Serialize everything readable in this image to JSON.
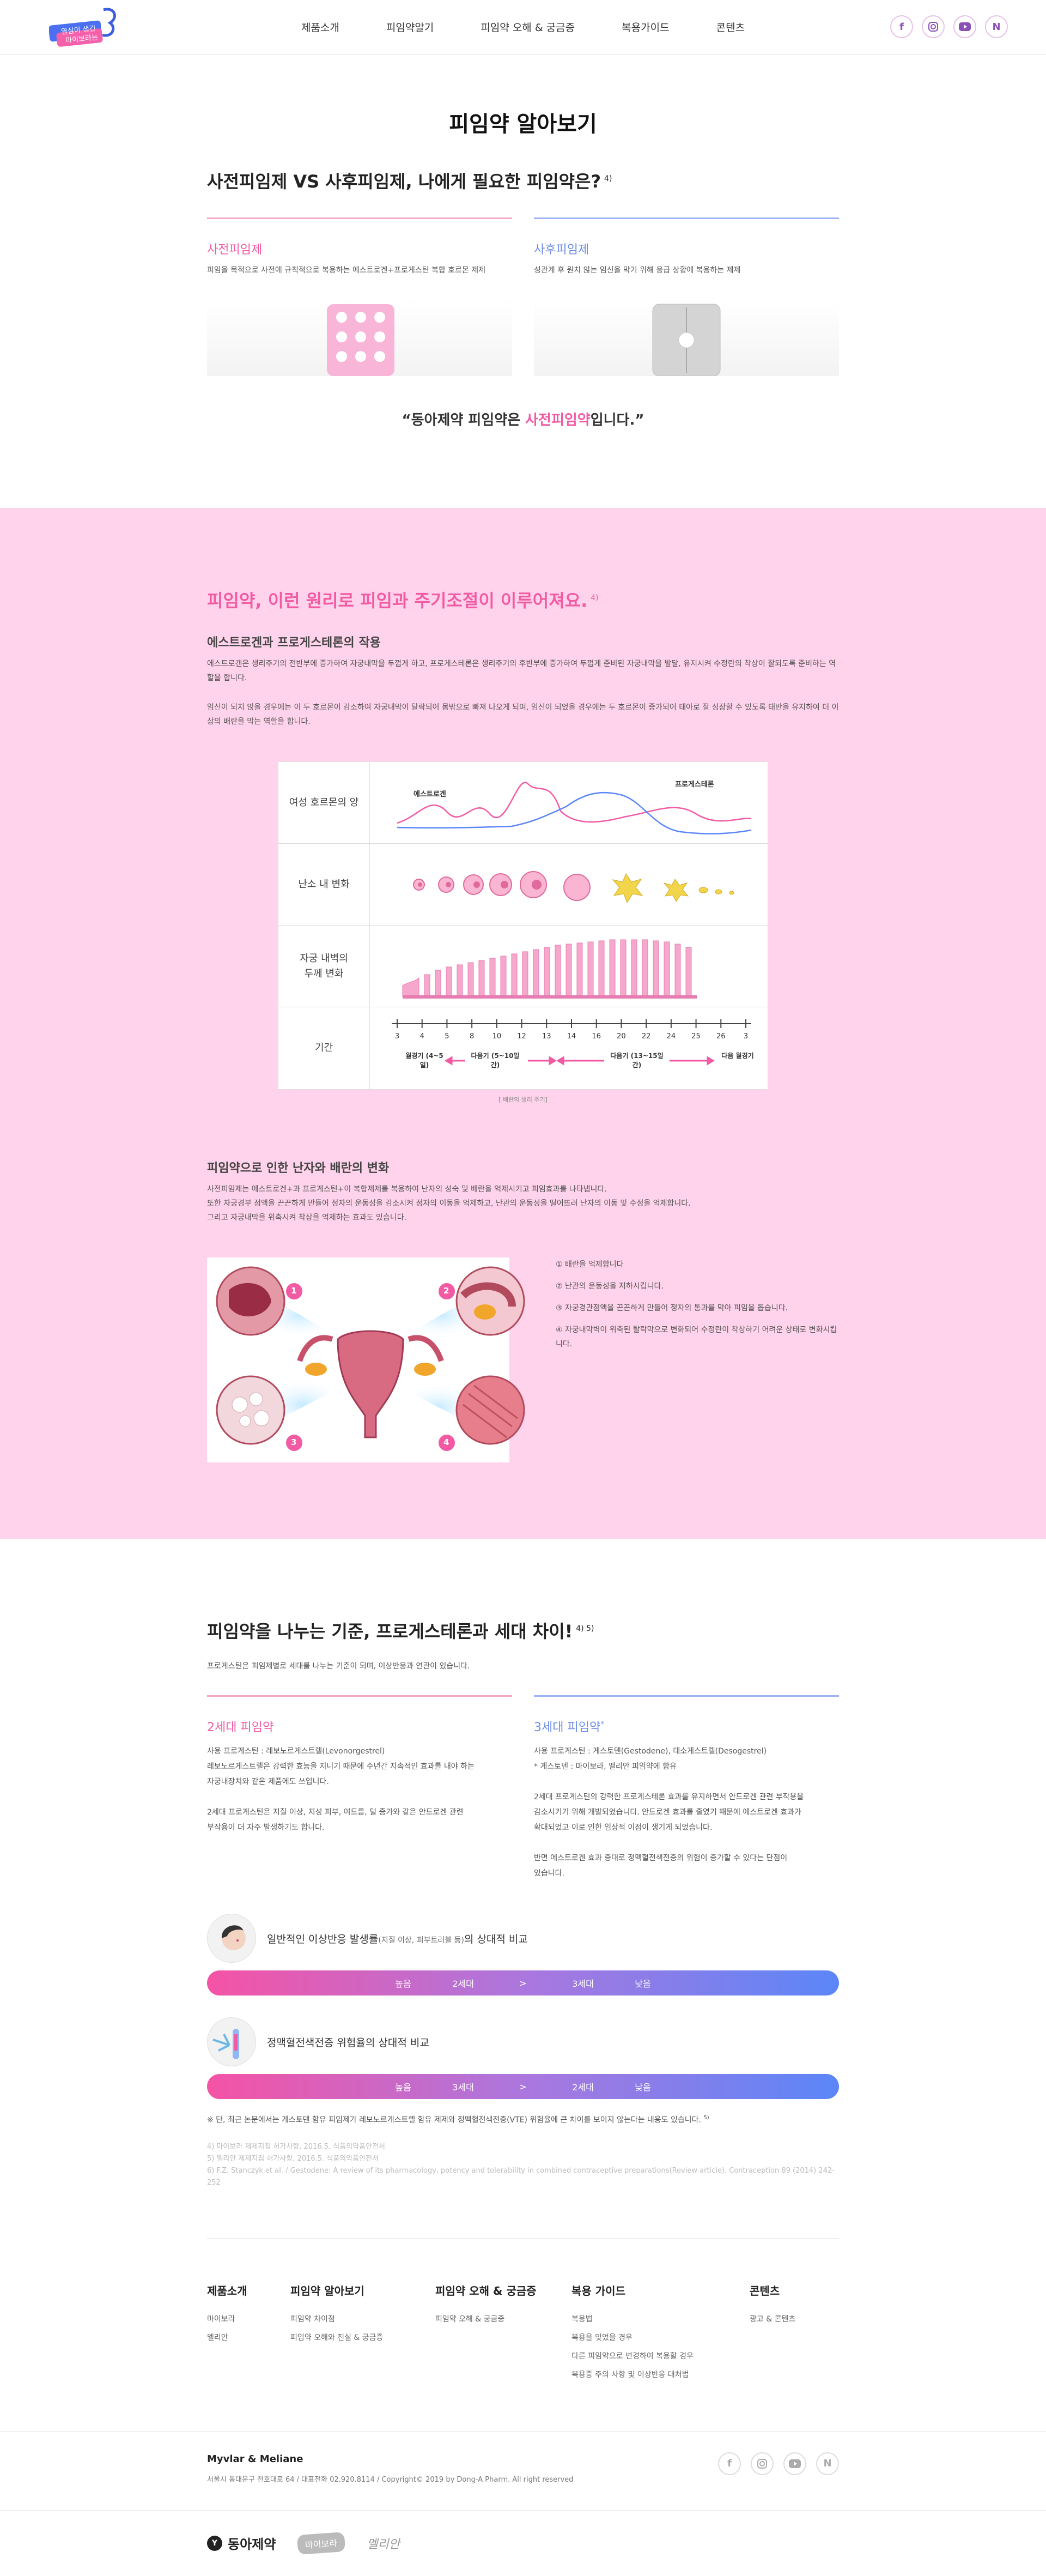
{
  "header": {
    "logo_alt": "Dong-A Pharm Myvlar",
    "nav": [
      "제품소개",
      "피임약알기",
      "피임약 오해 & 궁금증",
      "복용가이드",
      "콘텐츠"
    ],
    "sns": [
      "facebook-icon",
      "instagram-icon",
      "youtube-icon",
      "naver-icon"
    ]
  },
  "page_title": "피임약 알아보기",
  "section1": {
    "title": "사전피임제 VS 사후피임제, 나에게 필요한 피임약은?",
    "title_ref": "4)",
    "left_head": "사전피임제",
    "left_desc": "피임을 목적으로 사전에 규칙적으로 복용하는 에스트로겐+프로게스틴 복합 호르몬 제제",
    "right_head": "사후피임제",
    "right_desc": "성관계 후 원치 않는 임신을 막기 위해 응급 상황에 복용하는 제제",
    "quote_prefix": "“동아제약 피임약은 ",
    "quote_highlight": "사전피임약",
    "quote_suffix": "입니다.”"
  },
  "section2": {
    "title": "피임약, 이런 원리로 피임과 주기조절이 이루어져요.",
    "title_ref": "4)",
    "sub1": "에스트로겐과 프로게스테론의 작용",
    "p1": "에스트로겐은 생리주기의 전반부에 증가하여 자궁내막을 두껍게 하고, 프로게스테론은 생리주기의 후반부에 증가하여 두껍게 준비된 자궁내막을 발달, 유지시켜 수정란의 착상이 잘되도록 준비하는 역할을 합니다.",
    "p2": "임신이 되지 않을 경우에는 이 두 호르몬이 감소하여 자궁내막이 탈락되어 몸밖으로 빠져 나오게 되며, 임신이 되었을 경우에는 두 호르몬이 증가되어 태아로 잘 성장할 수 있도록 태반을 유지하여 더 이상의 배란을 막는 역할을 합니다.",
    "chart": {
      "row1_label": "여성 호르몬의 양",
      "estrogen": "에스트로겐",
      "progesterone": "프로게스테론",
      "row2_label": "난소 내 변화",
      "row3_label": "자궁 내벽의 두께 변화",
      "row4_label": "기간",
      "days": [
        "3",
        "4",
        "5",
        "8",
        "10",
        "12",
        "13",
        "14",
        "16",
        "20",
        "22",
        "24",
        "25",
        "26",
        "3"
      ],
      "phase1": "월경기 (4~5일)",
      "phase2": "다음기 (5~10일간)",
      "phase3": "다음기 (13~15일간)",
      "phase4": "다음 월경기",
      "note": "[ 배란의 생리 주기]"
    },
    "sub2": "피임약으로 인한 난자와 배란의 변화",
    "p3": "사전피임제는 에스트로겐+과 프로게스틴+이 복합제제를 복용하여 난자의 성숙 및 배란을 억제시키고 피임효과를 나타냅니다.",
    "p4": "또한 자궁경부 점액을 끈끈하게 만들어 정자의 운동성을 감소시켜 정자의 이동을 억제하고, 난관의 운동성을 떨어뜨려 난자의 이동 및 수정을 억제합니다.",
    "p5": "그리고 자궁내막을 위축시켜 착상을 억제하는 효과도 있습니다.",
    "list": [
      "① 배란을 억제합니다",
      "② 난관의 운동성을 저하시킵니다.",
      "③ 자궁경관점액을 끈끈하게 만들어 정자의 통과를 막아 피임을 돕습니다.",
      "④ 자궁내막벽이 위축된 탈락막으로 변화되어 수정란이 착상하기 어려운 상태로 변화시킵니다."
    ],
    "markers": [
      "1",
      "2",
      "3",
      "4"
    ]
  },
  "section3": {
    "title": "피임약을 나누는 기준, 프로게스테론과 세대 차이!",
    "title_ref": "4) 5)",
    "intro": "프로게스틴은 피임제별로 세대를 나누는 기준이 되며, 이상반응과 연관이 있습니다.",
    "left_head": "2세대 피임약",
    "left_l1": "사용 프로게스틴 : 레보노르게스트렐(Levonorgestrel)",
    "left_l2": "레보노르게스트렐은 강력한 효능을 지니기 때문에 수년간 지속적인 효과를 내야 하는",
    "left_l3": "자궁내장치와 같은 제품에도 쓰입니다.",
    "left_l4": "2세대 프로게스틴은 지질 이상, 지성 피부, 여드름, 털 증가와 같은 안드로겐 관련",
    "left_l5": "부작용이 더 자주 발생하기도 합니다.",
    "right_head": "3세대 피임약",
    "right_head_mark": "*",
    "right_l1": "사용 프로게스틴 : 게스토덴(Gestodene), 데소게스트렐(Desogestrel)",
    "right_l2": "* 게스토덴 : 마이보라, 멜리안 피임약에 함유",
    "right_l3": "2세대 프로게스틴의 강력한 프로게스테론 효과를 유지하면서 안드로겐 관련 부작용을",
    "right_l4": "감소시키기 위해 개발되었습니다. 안드로겐 효과를 줄였기 때문에 에스트로겐 효과가",
    "right_l5": "확대되었고 이로 인한 임상적 이점이 생기게 되었습니다.",
    "right_l6": "반면 에스트로겐 효과 증대로 정맥혈전색전증의 위험이 증가할 수 있다는 단점이",
    "right_l7": "있습니다.",
    "bar1_title": "일반적인 이상반응 발생률",
    "bar1_small": "(지질 이상, 피부트러블 등)",
    "bar1_suffix": "의 상대적 비교",
    "bar1": [
      "높음",
      "2세대",
      ">",
      "3세대",
      "낮음"
    ],
    "bar2_title": "정맥혈전색전증 위험율의 상대적 비교",
    "bar2": [
      "높음",
      "3세대",
      ">",
      "2세대",
      "낮음"
    ],
    "bar_note": "※ 단, 최근 논문에서는 게스토덴 함유 피임제가 레보노르게스트렐 함유 제제와 정맥혈전색전증(VTE) 위험율에 큰 차이를 보이지 않는다는 내용도 있습니다.",
    "bar_note_ref": "5)",
    "refs": [
      "4) 마이보라 제제지침 허가사항, 2016.5. 식품의약품안전처",
      "5) 멜리안 제제지침 허가사항, 2016.5. 식품의약품안전처",
      "6) F.Z. Stanczyk et al. / Gestodene: A review of its pharmacology, potency and tolerability in combined contraceptive preparations(Review article). Contraception 89 (2014) 242-252"
    ]
  },
  "footer": {
    "menu": [
      {
        "head": "제품소개",
        "items": [
          "마이보라",
          "멜리안"
        ]
      },
      {
        "head": "피임약 알아보기",
        "items": [
          "피임약 차이점",
          "피임약 오해와 진실 & 궁금증"
        ]
      },
      {
        "head": "피임약 오해 & 궁금증",
        "items": [
          "피임약 오해 & 궁금증"
        ]
      },
      {
        "head": "복용 가이드",
        "items": [
          "복용법",
          "복용을 잊었을 경우",
          "다른 피임약으로 변경하여 복용할 경우",
          "복용중 주의 사항 및 이상반응 대처법"
        ]
      },
      {
        "head": "콘텐츠",
        "items": [
          "광고 & 콘텐츠"
        ]
      }
    ],
    "brand_title": "Myvlar & Meliane",
    "address": "서울시 동대문구 천호대로 64 / 대표전화 02.920.8114 / Copyright© 2019 by Dong-A Pharm. All right reserved",
    "brands": [
      "동아제약",
      "마이보라",
      "멜리안"
    ]
  }
}
